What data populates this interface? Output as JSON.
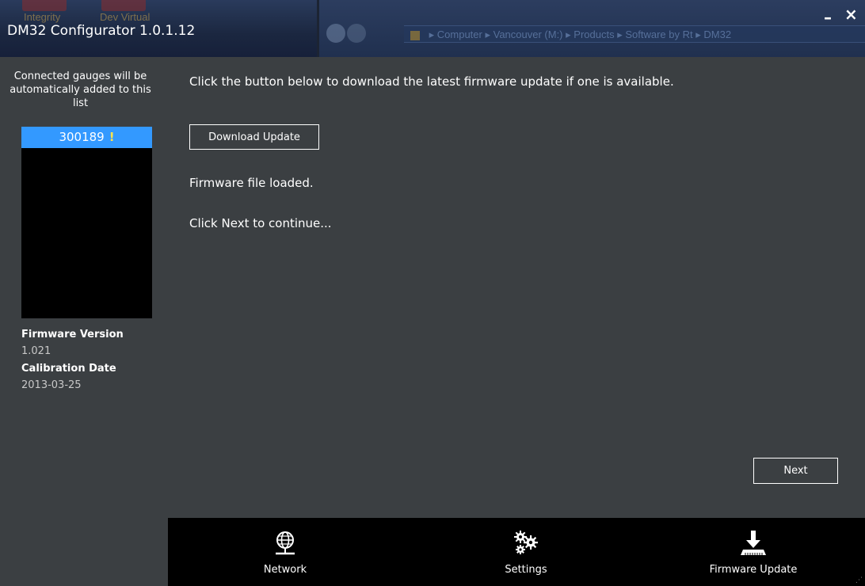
{
  "window": {
    "title": "DM32 Configurator 1.0.1.12",
    "minimize_glyph": "–",
    "close_glyph": "×"
  },
  "background_ghost": {
    "desktop_icons": [
      "Integrity",
      "Dev Virtual"
    ],
    "explorer_path": [
      "Computer",
      "Vancouver (M:)",
      "Products",
      "Software by Rt",
      "DM32"
    ]
  },
  "sidebar": {
    "hint": "Connected gauges will be automatically added to this list",
    "gauges": [
      {
        "id": "300189",
        "warning": "!",
        "selected": true
      }
    ],
    "firmware_version_label": "Firmware Version",
    "firmware_version_value": "1.021",
    "calibration_date_label": "Calibration Date",
    "calibration_date_value": "2013-03-25"
  },
  "main": {
    "instruction": "Click the button below to download the latest firmware update if one is available.",
    "download_button_label": "Download Update",
    "status_loaded": "Firmware file loaded.",
    "status_continue": "Click Next to continue...",
    "next_button_label": "Next"
  },
  "bottom_nav": {
    "items": [
      {
        "label": "Network",
        "icon": "globe-network-icon",
        "active": false
      },
      {
        "label": "Settings",
        "icon": "gears-icon",
        "active": false
      },
      {
        "label": "Firmware Update",
        "icon": "download-tray-icon",
        "active": true
      }
    ]
  },
  "colors": {
    "background": "#3b3f42",
    "titlebar": "#1c2433",
    "gauge_list_bg": "#000000",
    "selected_gauge": "#3399ff",
    "warning": "#ffe34d",
    "nav_bar": "#000000"
  }
}
